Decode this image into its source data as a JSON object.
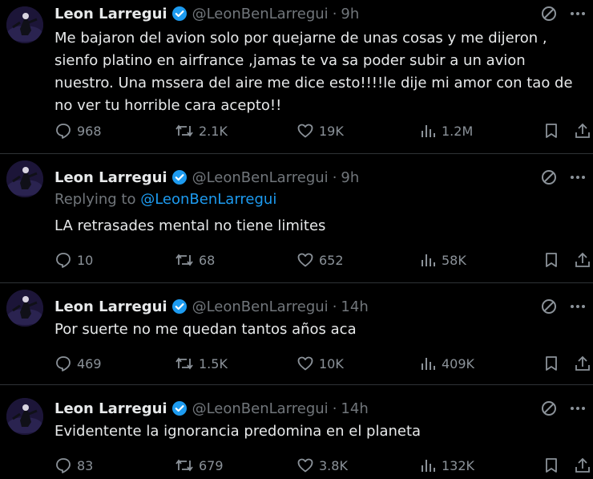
{
  "tweets": [
    {
      "name": "Leon Larregui",
      "handle": "@LeonBenLarregui",
      "dot": "·",
      "time": "9h",
      "replying_to": null,
      "text": "Me bajaron del avion solo por quejarne de unas cosas y me dijeron , sienfo platino en airfrance ,jamas te va sa poder subir a un avion nuestro. Una mssera del aire me dice esto!!!!le dije mi amor con tao de no ver tu horrible cara acepto!!",
      "replies": "968",
      "reposts": "2.1K",
      "likes": "19K",
      "views": "1.2M"
    },
    {
      "name": "Leon Larregui",
      "handle": "@LeonBenLarregui",
      "dot": "·",
      "time": "9h",
      "replying_to": {
        "prefix": "Replying to",
        "handle": "@LeonBenLarregui"
      },
      "text": "LA retrasades mental no tiene limites",
      "replies": "10",
      "reposts": "68",
      "likes": "652",
      "views": "58K"
    },
    {
      "name": "Leon Larregui",
      "handle": "@LeonBenLarregui",
      "dot": "·",
      "time": "14h",
      "replying_to": null,
      "text": "Por suerte no me quedan tantos años aca",
      "replies": "469",
      "reposts": "1.5K",
      "likes": "10K",
      "views": "409K"
    },
    {
      "name": "Leon Larregui",
      "handle": "@LeonBenLarregui",
      "dot": "·",
      "time": "14h",
      "replying_to": null,
      "text": "Evidentente la ignorancia predomina en el planeta",
      "replies": "83",
      "reposts": "679",
      "likes": "3.8K",
      "views": "132K"
    }
  ],
  "icons": {
    "verified": "verified-badge-icon",
    "grok": "grok-icon",
    "more": "more-icon",
    "reply": "reply-icon",
    "repost": "repost-icon",
    "like": "heart-icon",
    "views": "views-icon",
    "bookmark": "bookmark-icon",
    "share": "share-icon"
  },
  "colors": {
    "background": "#000000",
    "text": "#e7e9ea",
    "muted": "#71767b",
    "link": "#1d9bf0",
    "verified": "#1d9bf0",
    "divider": "#2f3336"
  }
}
